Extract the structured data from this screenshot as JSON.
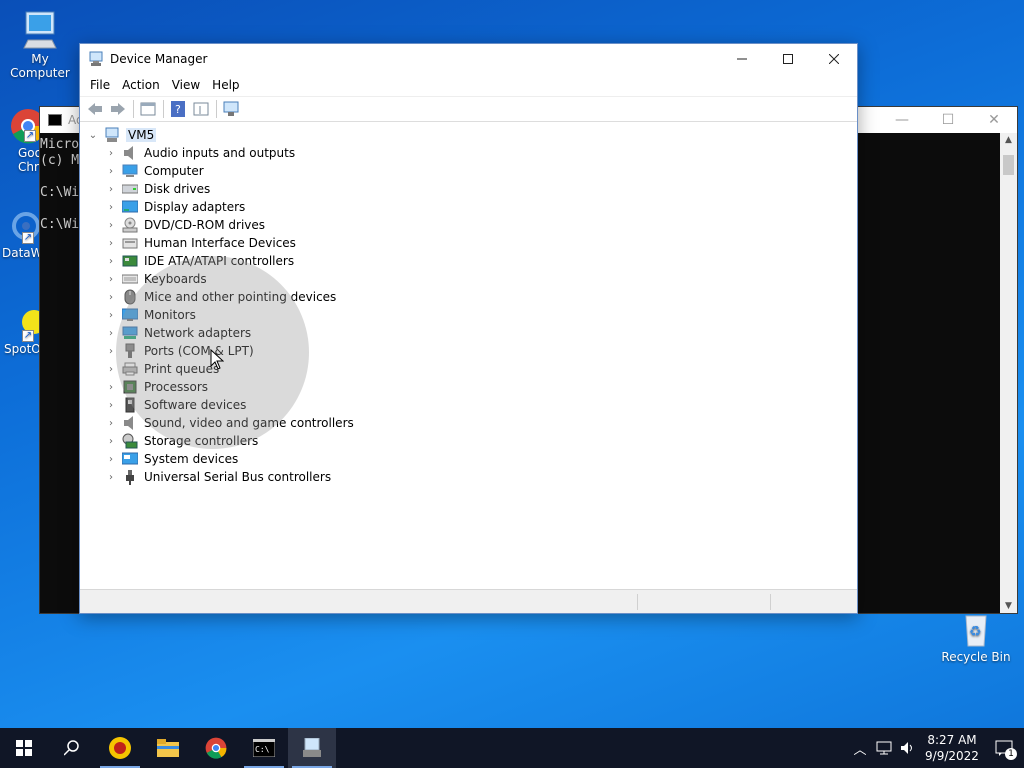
{
  "desktop": {
    "icons": [
      {
        "label": "My Computer"
      },
      {
        "label": "Goo\nChro"
      },
      {
        "label": "DataW"
      },
      {
        "label": "SpotO"
      }
    ],
    "recycle_bin": "Recycle Bin"
  },
  "console": {
    "title": "Ad",
    "lines": "Micro\n(c) M\n\nC:\\Wi\n\nC:\\Wi"
  },
  "device_manager": {
    "title": "Device Manager",
    "menu": [
      "File",
      "Action",
      "View",
      "Help"
    ],
    "root": "VM5",
    "categories": [
      {
        "label": "Audio inputs and outputs",
        "icon": "speaker-icon"
      },
      {
        "label": "Computer",
        "icon": "computer-icon"
      },
      {
        "label": "Disk drives",
        "icon": "disk-drive-icon"
      },
      {
        "label": "Display adapters",
        "icon": "display-adapter-icon"
      },
      {
        "label": "DVD/CD-ROM drives",
        "icon": "dvd-drive-icon"
      },
      {
        "label": "Human Interface Devices",
        "icon": "hid-icon"
      },
      {
        "label": "IDE ATA/ATAPI controllers",
        "icon": "ide-controller-icon"
      },
      {
        "label": "Keyboards",
        "icon": "keyboard-icon"
      },
      {
        "label": "Mice and other pointing devices",
        "icon": "mouse-icon"
      },
      {
        "label": "Monitors",
        "icon": "monitor-icon"
      },
      {
        "label": "Network adapters",
        "icon": "network-adapter-icon"
      },
      {
        "label": "Ports (COM & LPT)",
        "icon": "port-icon"
      },
      {
        "label": "Print queues",
        "icon": "printer-icon"
      },
      {
        "label": "Processors",
        "icon": "processor-icon"
      },
      {
        "label": "Software devices",
        "icon": "software-device-icon"
      },
      {
        "label": "Sound, video and game controllers",
        "icon": "sound-controller-icon"
      },
      {
        "label": "Storage controllers",
        "icon": "storage-controller-icon"
      },
      {
        "label": "System devices",
        "icon": "system-device-icon"
      },
      {
        "label": "Universal Serial Bus controllers",
        "icon": "usb-icon"
      }
    ]
  },
  "taskbar": {
    "time": "8:27 AM",
    "date": "9/9/2022",
    "notification_count": "1"
  }
}
